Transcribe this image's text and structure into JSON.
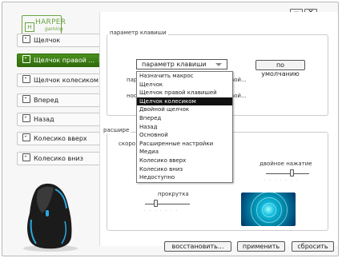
{
  "window_controls": {
    "minimize": "−",
    "close": "✕"
  },
  "logo": {
    "letter": "H",
    "brand": "HARPER",
    "sub": "gaming"
  },
  "sidebar": {
    "items": [
      {
        "label": "Щелчок",
        "active": false
      },
      {
        "label": "Щелчок правой ...",
        "active": true
      },
      {
        "label": "Щелчок колесиком",
        "active": false
      },
      {
        "label": "Вперед",
        "active": false
      },
      {
        "label": "Назад",
        "active": false
      },
      {
        "label": "Колесико вверх",
        "active": false
      },
      {
        "label": "Колесико вниз",
        "active": false
      }
    ],
    "active_arrow": ">"
  },
  "key_settings": {
    "group_title": "параметр клавиши",
    "dropdown_value": "параметр клавиши",
    "default_button": "по умолчанию",
    "row1_label_left": "пар",
    "row1_label_right": "вой...",
    "row2_label_left": "нос",
    "row2_label_right": "вой..."
  },
  "dropdown_menu": {
    "items": [
      "Назначить макрос",
      "Щелчок",
      "Щелчок правой клавишей",
      "Щелчок колесиком",
      "Двойной щелчок",
      "Вперед",
      "Назад",
      "Основной",
      "Расширенные настройки",
      "Медиа",
      "Колесико вверх",
      "Колесико вниз",
      "Недоступно"
    ],
    "selected_index": 3
  },
  "advanced": {
    "group_title": "расшире",
    "speed_label": "скоро",
    "double_click_label": "двойное нажатие",
    "scroll_label": "прокрутка"
  },
  "footer": {
    "restore": "восстановить...",
    "apply": "применить",
    "reset": "сбросить"
  }
}
